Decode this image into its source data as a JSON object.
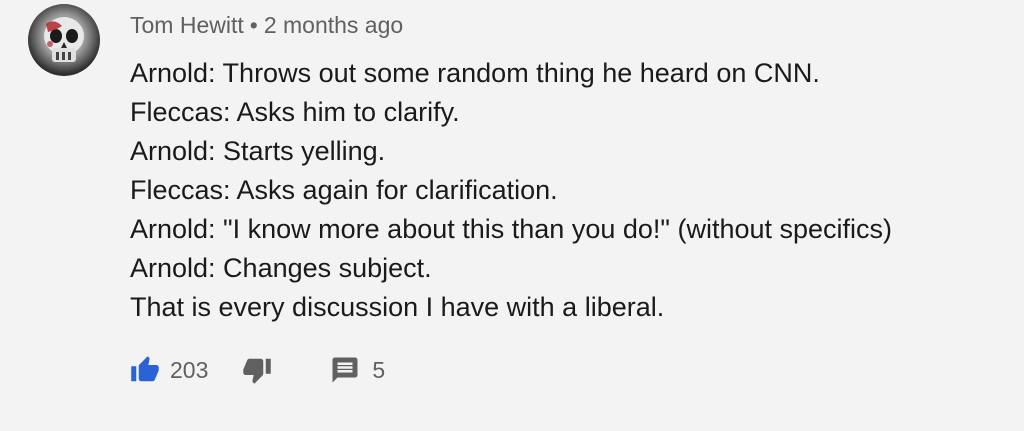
{
  "comment": {
    "author": "Tom Hewitt",
    "separator": "•",
    "timestamp": "2 months ago",
    "lines": [
      "Arnold: Throws out some random thing he heard on CNN.",
      "Fleccas: Asks him to clarify.",
      "Arnold: Starts yelling.",
      "Fleccas: Asks again for clarification.",
      "Arnold: \"I know more about this than you do!\" (without specifics)",
      "Arnold: Changes subject.",
      "That is every discussion I have with a liberal."
    ],
    "likes": "203",
    "replies": "5"
  },
  "colors": {
    "like_active": "#2a63d4",
    "icon_gray": "#606060",
    "background": "#f3f3f3"
  },
  "icons": {
    "like": "thumbs-up-icon",
    "dislike": "thumbs-down-icon",
    "reply": "comment-icon"
  }
}
